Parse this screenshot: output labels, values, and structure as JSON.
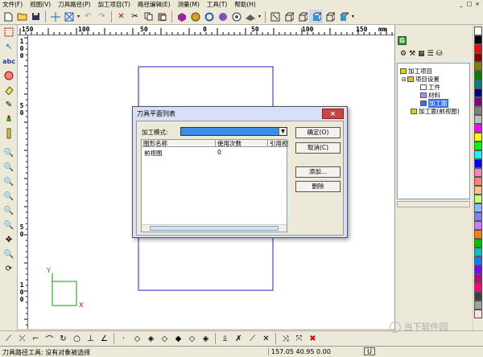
{
  "menu": [
    "文件(F)",
    "视图(V)",
    "刀具路径(P)",
    "加工项目(T)",
    "路径编辑(E)",
    "测量(M)",
    "工具(T)",
    "帮助(H)"
  ],
  "window_buttons": [
    "_",
    "□",
    "×"
  ],
  "ruler": {
    "h_labels": [
      "150",
      "100",
      "50",
      "0",
      "50",
      "100",
      "150",
      "mm"
    ],
    "v_labels": [
      [
        "1",
        "0",
        "0"
      ],
      [
        "5",
        "0"
      ],
      [
        "5",
        "0"
      ],
      [
        "1",
        "0",
        "0"
      ]
    ]
  },
  "right_panel": {
    "tab_label": "G",
    "tree": [
      {
        "label": "加工项目",
        "color": "#e8d000"
      },
      {
        "label": "项目设置",
        "color": "#e8c000"
      },
      {
        "label": "工件",
        "color": "#ffffff"
      },
      {
        "label": "材料",
        "color": "#c080ff"
      },
      {
        "label": "加工面",
        "color": "#3a6ee8",
        "selected": true
      },
      {
        "label": "加工面(前视图)",
        "color": "#e8d000"
      }
    ]
  },
  "palette_colors": [
    "#ffffff",
    "#000000",
    "#ff0000",
    "#800000",
    "#808000",
    "#008000",
    "#008080",
    "#000080",
    "#800080",
    "#808080",
    "#c0c0c0",
    "#ff00ff",
    "#ffff00",
    "#00ff00",
    "#00ffff",
    "#0000ff",
    "#ff80c0",
    "#ff8080",
    "#ffc080",
    "#c0ff80",
    "#80c0ff",
    "#8080ff",
    "#c080ff",
    "#ff8000",
    "#00c000",
    "#00c0c0",
    "#0080ff",
    "#8000ff",
    "#c00080",
    "#ff0080",
    "#404040",
    "#a0a0a0",
    "#ffe0e0"
  ],
  "dialog": {
    "title": "刀具平面列表",
    "close": "×",
    "mode_label": "加工模式:",
    "columns": [
      "图形名称",
      "使用次数",
      "引用视图"
    ],
    "rows": [
      {
        "name": "前视图",
        "count": "0"
      }
    ],
    "buttons": {
      "ok": "确定(O)",
      "cancel": "取消(C)",
      "add": "添加...",
      "delete": "删除"
    }
  },
  "axes": {
    "x": "X",
    "y": "Y"
  },
  "status": {
    "message": "刀具路径工具: 没有对象被选择",
    "coords": "157.05  40.95  0.00",
    "unit": "U"
  },
  "watermark": "当下软件园"
}
